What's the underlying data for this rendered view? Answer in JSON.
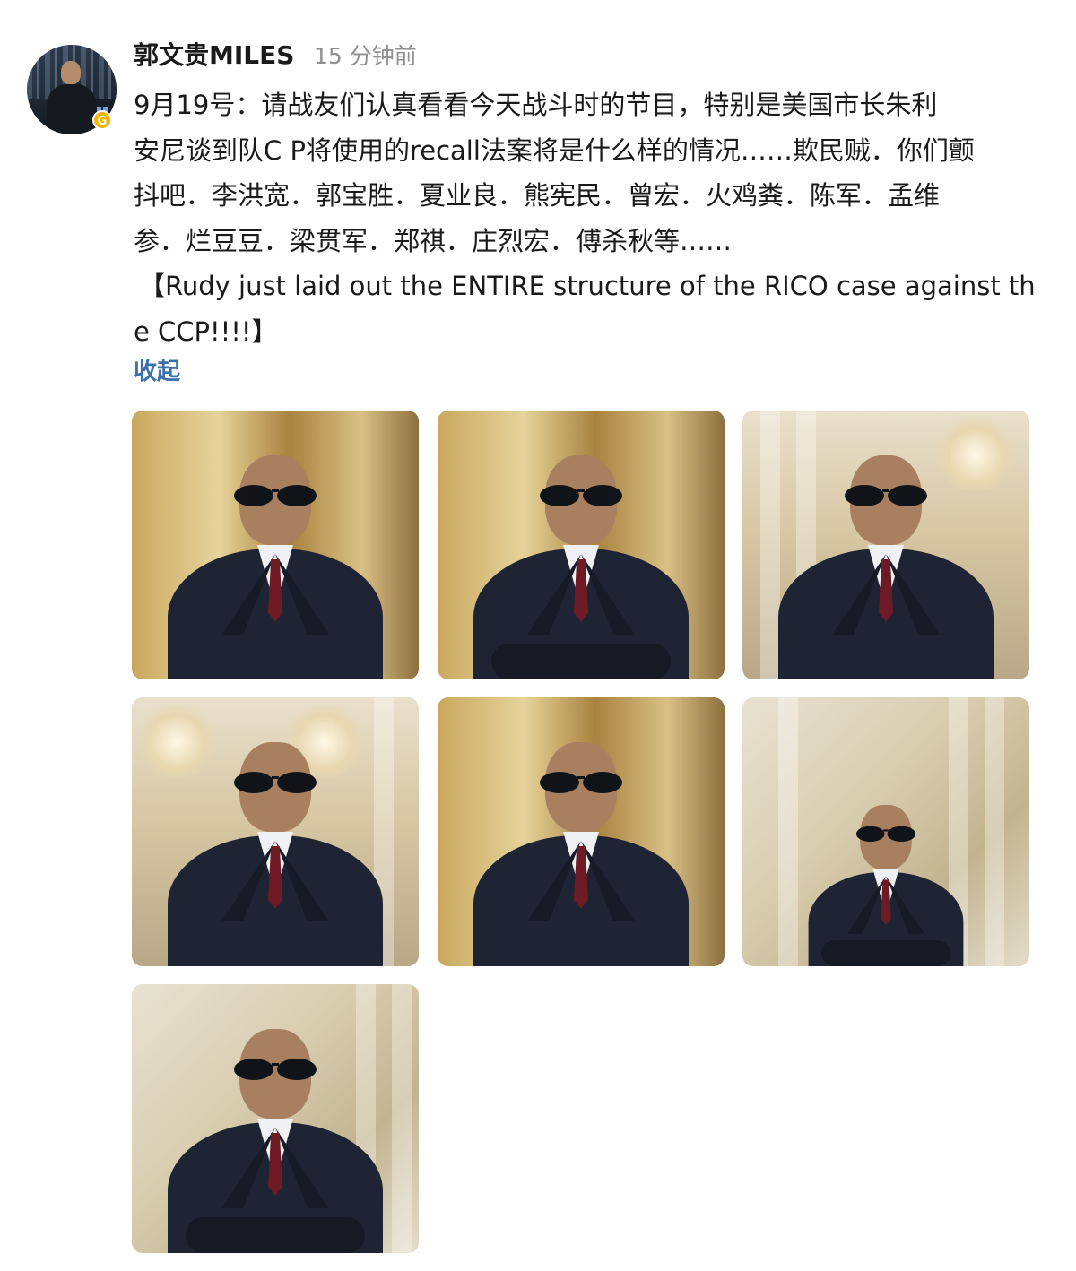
{
  "author": {
    "name": "郭文贵MILES",
    "time": "15 分钟前",
    "badge_icon": "verified-gold-badge-icon"
  },
  "post": {
    "lines": [
      "9月19号：请战友们认真看看今天战斗时的节目，特别是美国市长朱利",
      "安尼谈到队C P将使用的recall法案将是什么样的情况……欺民贼．你们颤",
      "抖吧．李洪宽．郭宝胜．夏业良．熊宪民．曾宏．火鸡粪．陈军．孟维",
      "参．烂豆豆．梁贯军．郑祺．庄烈宏．傅杀秋等……",
      "【Rudy just laid out the ENTIRE structure of the RICO case against th",
      "e CCP!!!!】"
    ],
    "collapse_label": "收起"
  },
  "accent_color": "#3a6fb0",
  "photos": [
    {
      "scene": "window-selfie"
    },
    {
      "scene": "window-arms-crossed"
    },
    {
      "scene": "dining-room"
    },
    {
      "scene": "chandelier-room"
    },
    {
      "scene": "window-selfie"
    },
    {
      "scene": "mural-arms-crossed"
    },
    {
      "scene": "mural-arms-crossed"
    }
  ]
}
